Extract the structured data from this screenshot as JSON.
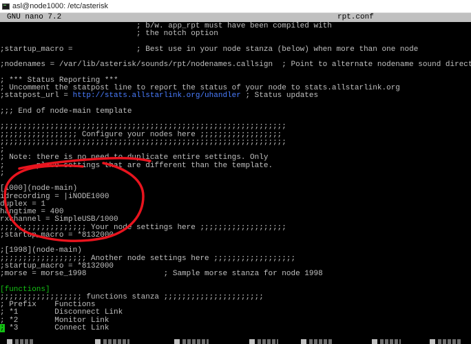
{
  "window": {
    "title": "asl@node1000: /etc/asterisk"
  },
  "nano": {
    "version": "GNU nano 7.2",
    "filename": "rpt.conf"
  },
  "editor": {
    "lines": [
      "                              ; b/w. app_rpt must have been compiled with",
      "                              ; the notch option",
      "",
      ";startup_macro =              ; Best use in your node stanza (below) when more than one node",
      "",
      ";nodenames = /var/lib/asterisk/sounds/rpt/nodenames.callsign  ; Point to alternate nodename sound directory",
      "",
      "; *** Status Reporting ***",
      "; Uncomment the statpost line to report the status of your node to stats.allstarlink.org",
      ";statpost_url = ",
      ";;; End of node-main template",
      "",
      ";;;;;;;;;;;;;;;;;;;;;;;;;;;;;;;;;;;;;;;;;;;;;;;;;;;;;;;;;;;;;;;",
      ";;;;;;;;;;;;;;;;; Configure your nodes here ;;;;;;;;;;;;;;;;;;",
      ";;;;;;;;;;;;;;;;;;;;;;;;;;;;;;;;;;;;;;;;;;;;;;;;;;;;;;;;;;;;;;;",
      ";",
      "; Note: there is no need to duplicate entire settings. Only",
      ";       place settings that are different than the template.",
      ";",
      "",
      "[1000](node-main)",
      "idrecording = |iNODE1000",
      "duplex = 1",
      "hangtime = 400",
      "rxchannel = SimpleUSB/1000",
      ";;;;;;;;;;;;;;;;;;; Your node settings here ;;;;;;;;;;;;;;;;;;;",
      ";startup_macro = *8132000",
      "",
      ";[1998](node-main)",
      ";;;;;;;;;;;;;;;;;;; Another node settings here ;;;;;;;;;;;;;;;;;;",
      ";startup_macro = *8132000",
      ";morse = morse_1998                 ; Sample morse stanza for node 1998",
      "",
      "[functions]",
      ";;;;;;;;;;;;;;;;;; functions stanza ;;;;;;;;;;;;;;;;;;;;;;",
      "; Prefix    Functions",
      "; *1        Disconnect Link",
      "; *2        Monitor Link",
      " *3        Connect Link"
    ],
    "statpost_link": "http://stats.allstarlink.org/uhandler",
    "statpost_suffix": " ; Status updates",
    "cursor_char": ";"
  },
  "colors": {
    "text": "#c0c0c0",
    "link": "#4a7dff",
    "section_header": "#14c114",
    "cursor": "#14c114",
    "annotation": "#e8141e",
    "header_bar": "#c0c0c0"
  }
}
